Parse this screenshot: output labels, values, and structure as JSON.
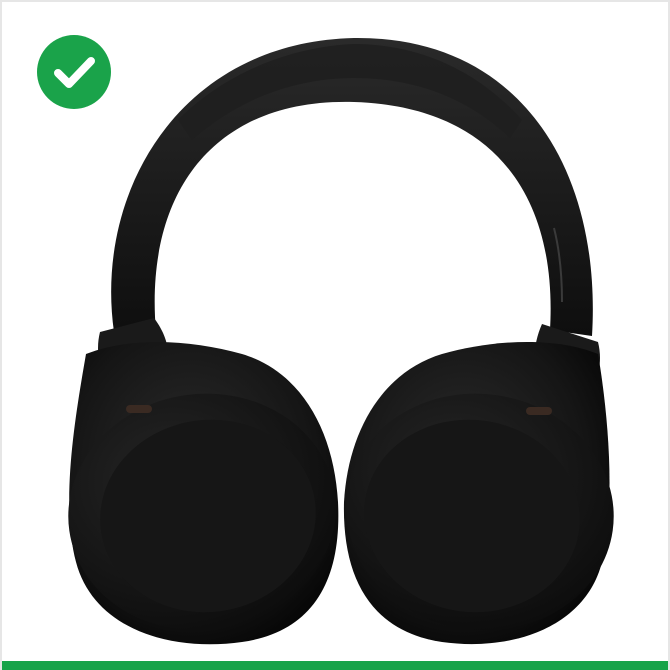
{
  "badge": {
    "icon": "check-circle-icon",
    "color": "#1aa34a"
  },
  "product": {
    "icon": "over-ear-headphones-image",
    "color": "#151515"
  },
  "accent": {
    "bottom_bar_color": "#17a34a"
  }
}
